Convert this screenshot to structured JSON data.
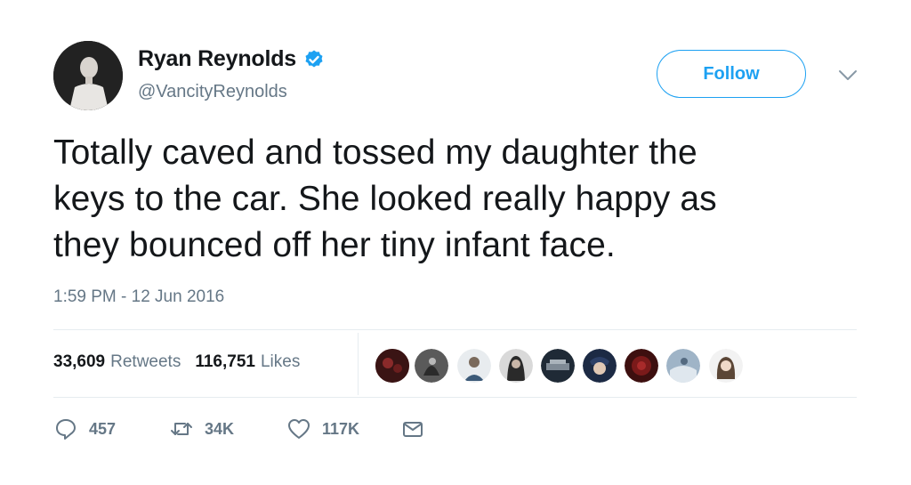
{
  "author": {
    "display_name": "Ryan Reynolds",
    "handle": "@VancityReynolds",
    "verified": true
  },
  "follow_label": "Follow",
  "tweet": {
    "lines": [
      "Totally caved and tossed my daughter the",
      "keys to the car. She looked really happy as",
      "they bounced off her tiny infant face."
    ],
    "timestamp": "1:59 PM - 12 Jun 2016"
  },
  "stats": {
    "retweets_count": "33,609",
    "retweets_label": "Retweets",
    "likes_count": "116,751",
    "likes_label": "Likes"
  },
  "actions": {
    "reply_count": "457",
    "retweet_count": "34K",
    "like_count": "117K"
  },
  "colors": {
    "brand_blue": "#1da1f2",
    "text_primary": "#14171a",
    "text_secondary": "#657786",
    "divider": "#e6ecf0"
  }
}
